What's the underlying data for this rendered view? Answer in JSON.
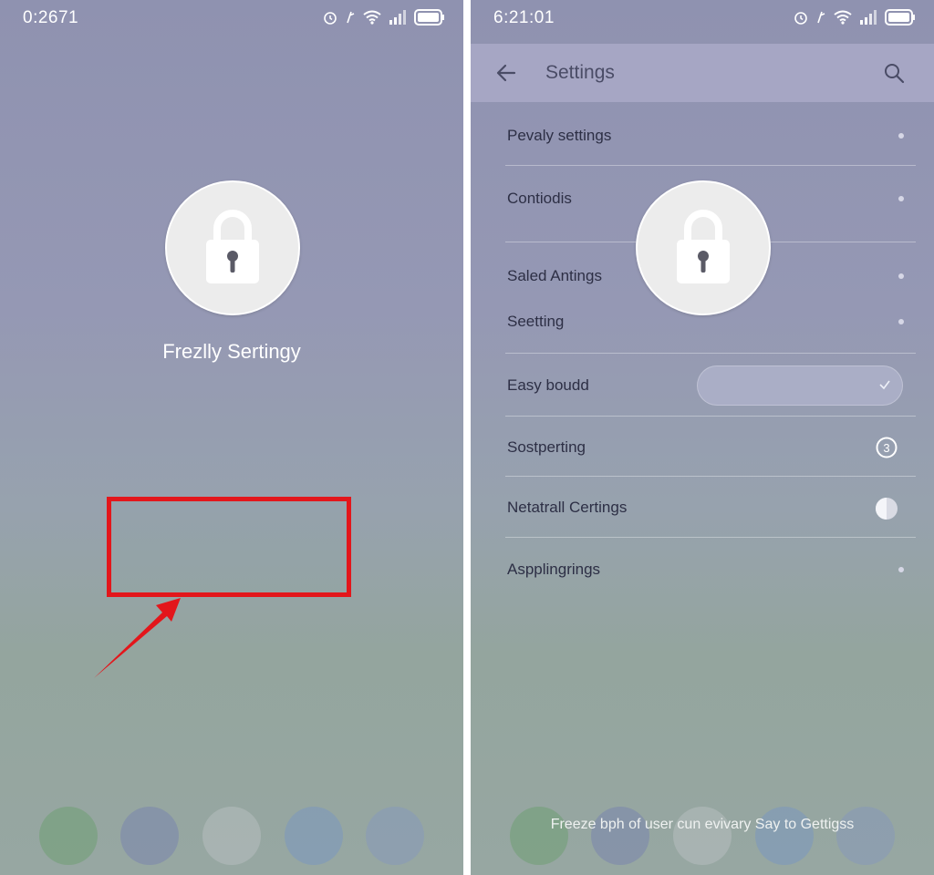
{
  "left_screen": {
    "status_time": "0:2671",
    "lock_label": "Frezlly Sertingy"
  },
  "right_screen": {
    "status_time": "6:21:01",
    "header_title": "Settings",
    "items": [
      {
        "label": "Pevaly settings"
      },
      {
        "label": "Contiodis"
      },
      {
        "label": "Saled Antings"
      },
      {
        "label": "Seetting"
      },
      {
        "label": "Easy boudd"
      },
      {
        "label": "Sostperting"
      },
      {
        "label": "Netatrall Certings"
      },
      {
        "label": "Aspplingrings"
      }
    ],
    "footer_text": "Freeze bph of user cun evivary Say to Gettigss"
  },
  "colors": {
    "highlight": "#e3161b",
    "appbar": "#a6a6c4",
    "lock_circle": "#ececec"
  },
  "icons": [
    "alarm-icon",
    "wifi-icon",
    "signal-icon",
    "battery-icon",
    "lock-icon",
    "back-arrow-icon",
    "search-icon",
    "check-icon",
    "info-icon",
    "toggle-icon"
  ]
}
